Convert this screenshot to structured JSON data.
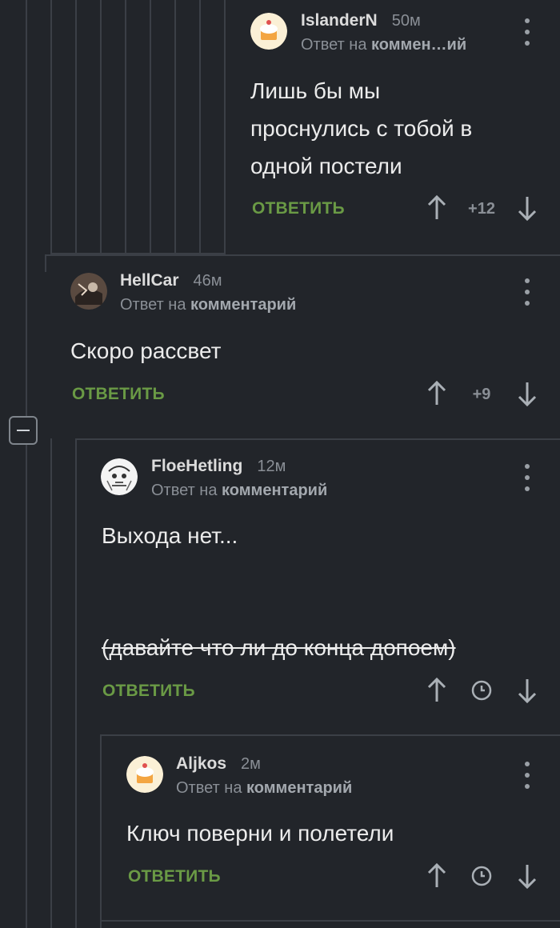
{
  "comments": [
    {
      "author": "IslanderN",
      "time": "50м",
      "reply_prefix": "Ответ на",
      "reply_target": "коммен…ий",
      "text_lines": [
        "Лишь бы мы",
        "проснулись с тобой в",
        "одной постели"
      ],
      "reply_label": "ОТВЕТИТЬ",
      "score": "+12",
      "avatar_icon": "cupcake-avatar"
    },
    {
      "author": "HellCar",
      "time": "46м",
      "reply_prefix": "Ответ на",
      "reply_target": "комментарий",
      "text_lines": [
        "Скоро рассвет"
      ],
      "reply_label": "ОТВЕТИТЬ",
      "score": "+9",
      "avatar_icon": "dark-photo-avatar"
    },
    {
      "author": "FloeHetling",
      "time": "12м",
      "reply_prefix": "Ответ на",
      "reply_target": "комментарий",
      "text_lines": [
        "Выхода нет..."
      ],
      "strike_text": "(давайте что ли до конца допоем)",
      "reply_label": "ОТВЕТИТЬ",
      "score_icon": "clock-icon",
      "avatar_icon": "sketch-avatar"
    },
    {
      "author": "Aljkos",
      "time": "2м",
      "reply_prefix": "Ответ на",
      "reply_target": "комментарий",
      "text_lines": [
        "Ключ поверни и полетели"
      ],
      "reply_label": "ОТВЕТИТЬ",
      "score_icon": "clock-icon",
      "avatar_icon": "cupcake-avatar"
    }
  ],
  "colors": {
    "background": "#22252a",
    "thread_line": "#3b3f46",
    "reply_green": "#6a9a45",
    "muted": "#8a8f96"
  }
}
